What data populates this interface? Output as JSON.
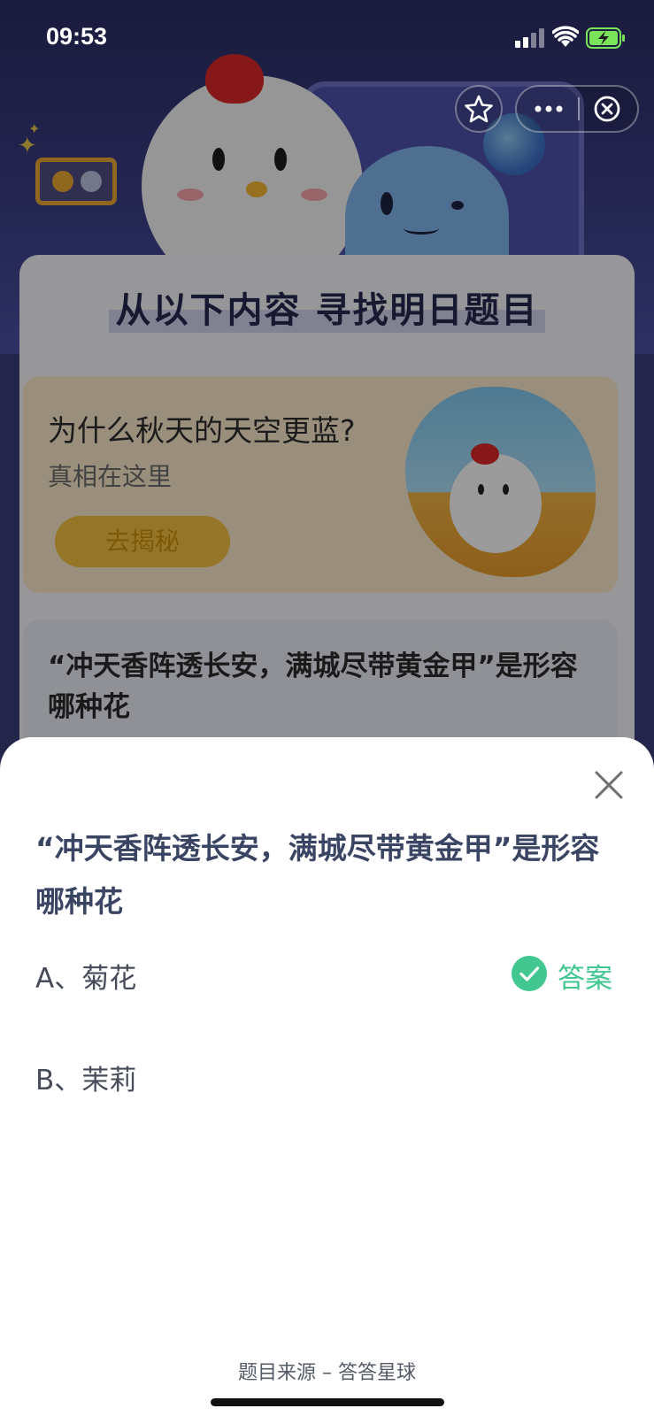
{
  "status_bar": {
    "time": "09:53"
  },
  "capsule": {
    "star_icon": "star-outline-icon",
    "more_icon": "more-dots-icon",
    "close_icon": "close-circle-icon"
  },
  "background_page": {
    "title": "从以下内容 寻找明日题目",
    "promo": {
      "question": "为什么秋天的天空更蓝?",
      "subtitle": "真相在这里",
      "button_label": "去揭秘"
    },
    "question_card": {
      "text": "“冲天香阵透长安，满城尽带黄金甲”是形容哪种花"
    }
  },
  "sheet": {
    "question": "“冲天香阵透长安，满城尽带黄金甲”是形容哪种花",
    "options": [
      {
        "label": "A、菊花",
        "is_answer": true
      },
      {
        "label": "B、茉莉",
        "is_answer": false
      }
    ],
    "answer_label": "答案",
    "source": "题目来源 – 答答星球"
  },
  "colors": {
    "answer_green": "#41c78f",
    "question_text": "#3a4463",
    "overlay": "rgba(0,0,0,0.38)"
  }
}
